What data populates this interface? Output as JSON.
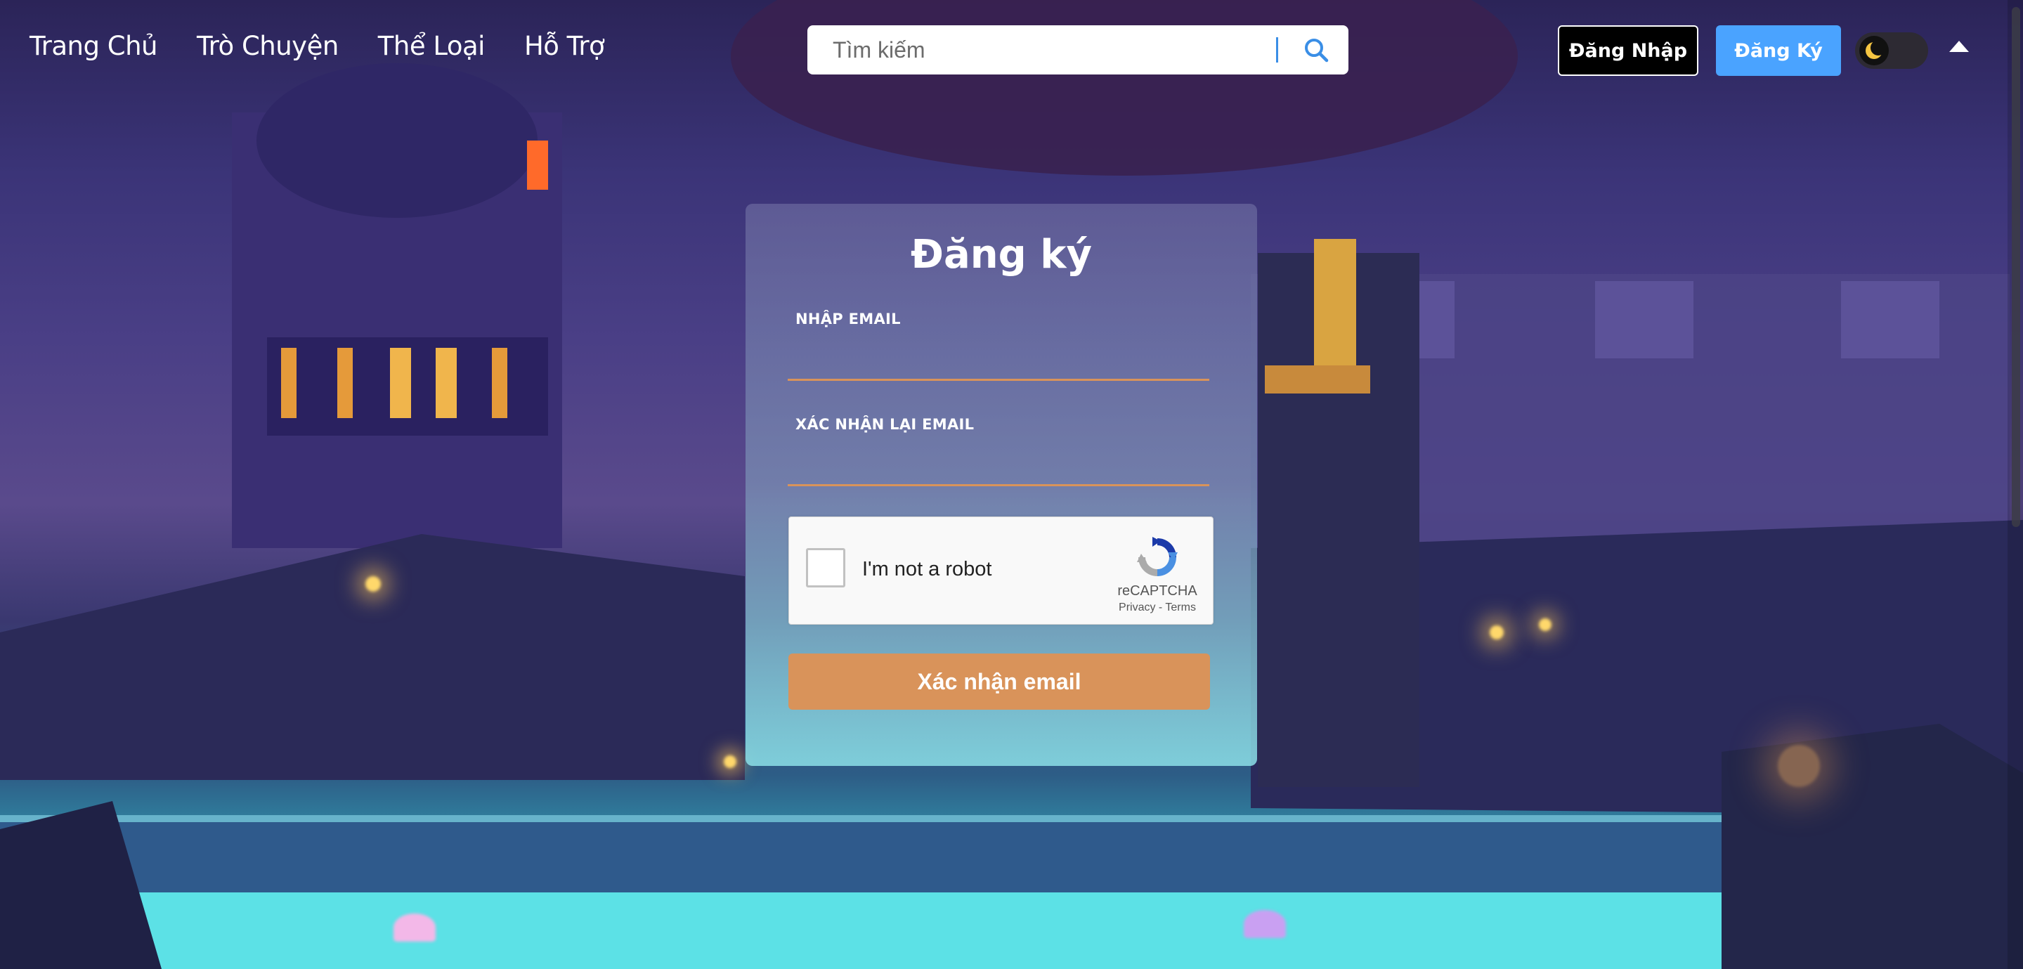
{
  "nav": {
    "links": [
      {
        "label": "Trang Chủ"
      },
      {
        "label": "Trò Chuyện"
      },
      {
        "label": "Thể Loại"
      },
      {
        "label": "Hỗ Trợ"
      }
    ],
    "search": {
      "placeholder": "Tìm kiếm",
      "value": ""
    },
    "login_label": "Đăng Nhập",
    "register_label": "Đăng Ký"
  },
  "form": {
    "title": "Đăng ký",
    "email_label": "NHẬP EMAIL",
    "email_value": "",
    "confirm_label": "XÁC NHẬN LẠI EMAIL",
    "confirm_value": "",
    "captcha": {
      "text": "I'm not a robot",
      "brand": "reCAPTCHA",
      "privacy": "Privacy",
      "separator": " - ",
      "terms": "Terms"
    },
    "submit_label": "Xác nhận email"
  },
  "colors": {
    "accent": "#d9935a",
    "register_button": "#4aa3ff",
    "login_button": "#000000"
  },
  "icons": {
    "search": "search-icon",
    "theme": "moon-icon",
    "scroll_top": "caret-up-icon"
  }
}
